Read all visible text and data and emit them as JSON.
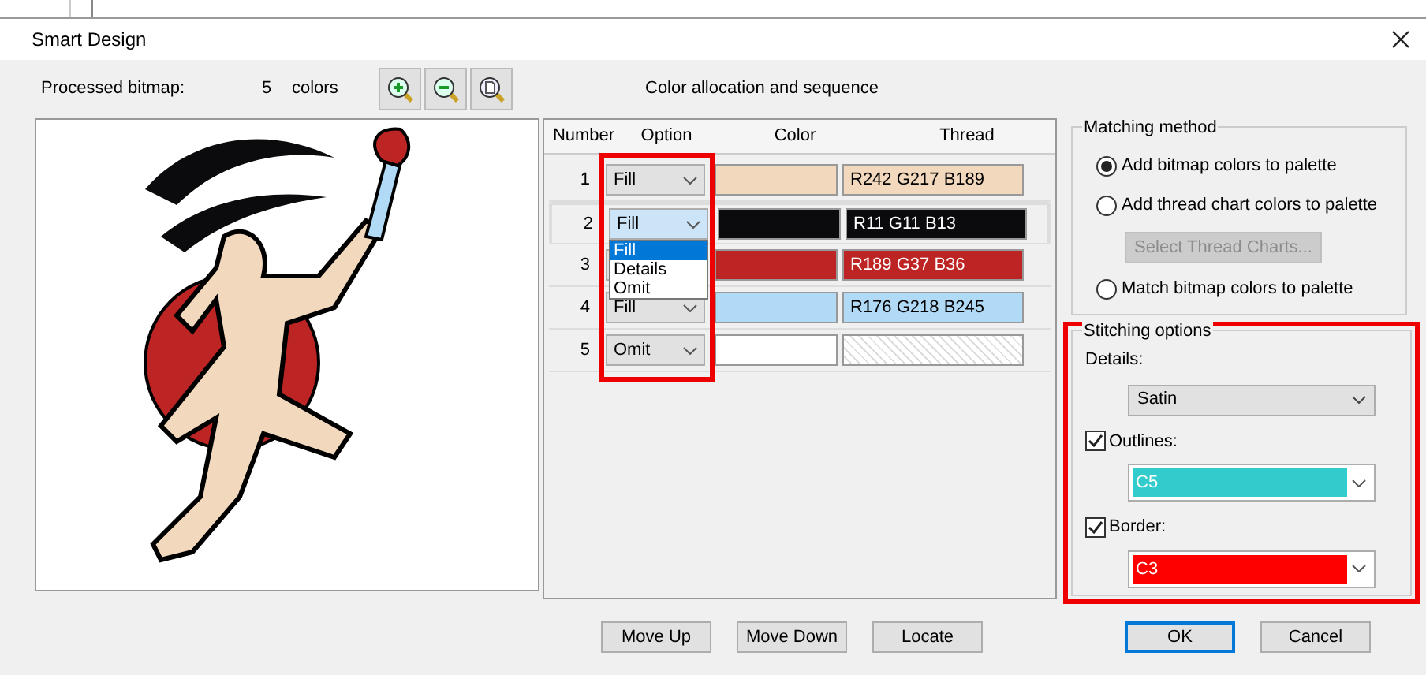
{
  "window": {
    "title": "Smart Design"
  },
  "bitmap": {
    "label": "Processed bitmap:",
    "count": "5",
    "unit": "colors"
  },
  "table": {
    "title": "Color allocation and sequence",
    "option_column_highlighted": true,
    "columns": [
      "Number",
      "Option",
      "Color",
      "Thread"
    ],
    "rows": [
      {
        "number": "1",
        "option": "Fill",
        "color": "#f2d9bd",
        "kind": "rgb",
        "thread": "R242 G217 B189",
        "selected": false
      },
      {
        "number": "2",
        "option": "Fill",
        "color": "#0b0b0d",
        "kind": "rgb",
        "thread": "R11 G11 B13",
        "selected": true,
        "menu": [
          {
            "label": "Fill",
            "selected": true
          },
          {
            "label": "Details",
            "selected": false
          },
          {
            "label": "Omit",
            "selected": false
          }
        ]
      },
      {
        "number": "3",
        "color": "#bd2524",
        "kind": "rgb",
        "thread": "R189 G37 B36",
        "selected": false
      },
      {
        "number": "4",
        "option": "Fill",
        "color": "#b0daf5",
        "kind": "rgb",
        "thread": "R176 G218 B245",
        "selected": false
      },
      {
        "number": "5",
        "option": "Omit",
        "color": "#ffffff",
        "kind": "empty",
        "selected": false
      }
    ]
  },
  "matching_method": {
    "title": "Matching method",
    "items": [
      {
        "kind": "radio",
        "label": "Add bitmap colors to palette",
        "selected": true
      },
      {
        "kind": "radio",
        "label": "Add thread chart colors to palette",
        "selected": false
      },
      {
        "kind": "button",
        "label": "Select Thread Charts...",
        "disabled": true
      },
      {
        "kind": "radio",
        "label": "Match bitmap colors to palette",
        "selected": false
      }
    ]
  },
  "stitching_options": {
    "title": "Stitching options",
    "highlighted": true,
    "details": {
      "label": "Details:",
      "value": "Satin"
    },
    "outlines": {
      "label": "Outlines:",
      "checked": true,
      "value": "C5",
      "color": "#33cccc"
    },
    "border": {
      "label": "Border:",
      "checked": true,
      "value": "C3",
      "color": "#ff0000"
    }
  },
  "sequence_buttons": [
    {
      "label": "Move Up",
      "default": false
    },
    {
      "label": "Move Down",
      "default": false
    },
    {
      "label": "Locate",
      "default": false
    }
  ],
  "dialog_buttons": [
    {
      "label": "OK",
      "default": true
    },
    {
      "label": "Cancel",
      "default": false
    }
  ]
}
